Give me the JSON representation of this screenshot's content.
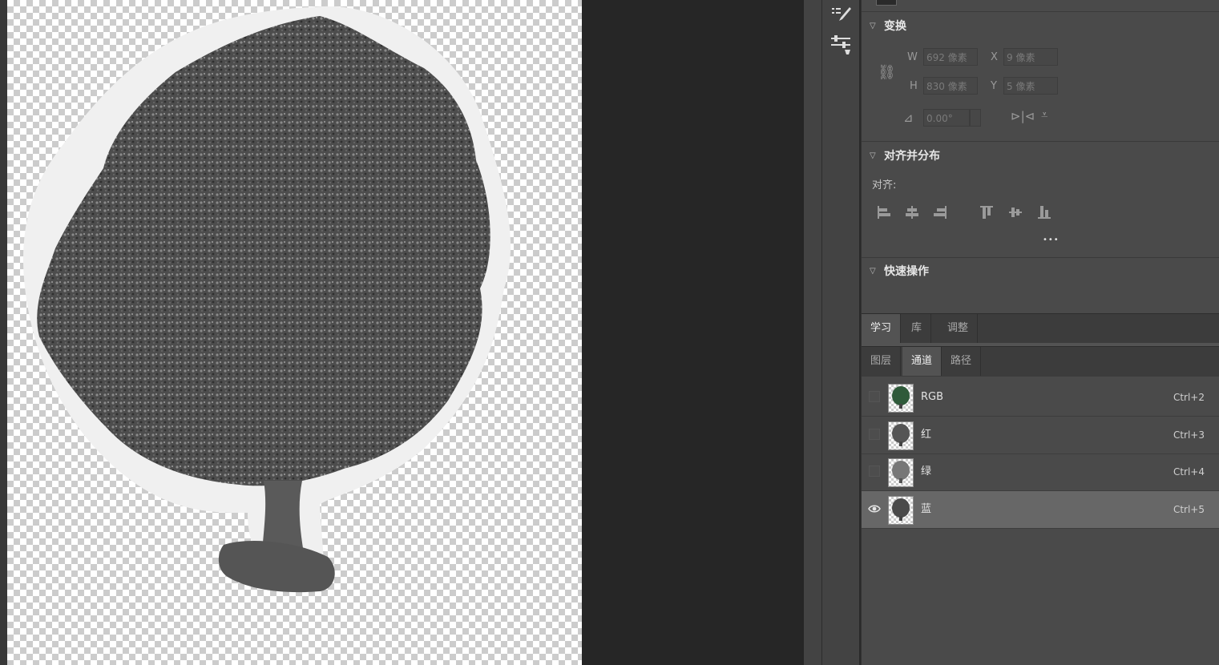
{
  "transform": {
    "title": "变换",
    "w_label": "W",
    "w_value": "692 像素",
    "x_label": "X",
    "x_value": "9 像素",
    "h_label": "H",
    "h_value": "830 像素",
    "y_label": "Y",
    "y_value": "5 像素",
    "angle_value": "0.00°"
  },
  "align": {
    "title": "对齐并分布",
    "label": "对齐:",
    "more": "•••"
  },
  "quick_actions": {
    "title": "快速操作"
  },
  "tabs_top": [
    {
      "label": "学习"
    },
    {
      "label": "库"
    },
    {
      "label": "调整"
    }
  ],
  "tabs_bottom": [
    {
      "label": "图层"
    },
    {
      "label": "通道"
    },
    {
      "label": "路径"
    }
  ],
  "channels": [
    {
      "name": "RGB",
      "shortcut": "Ctrl+2",
      "visible": false,
      "thumb_color": "#2f5a3a"
    },
    {
      "name": "红",
      "shortcut": "Ctrl+3",
      "visible": false,
      "thumb_color": "#555555"
    },
    {
      "name": "绿",
      "shortcut": "Ctrl+4",
      "visible": false,
      "thumb_color": "#777777"
    },
    {
      "name": "蓝",
      "shortcut": "Ctrl+5",
      "visible": true,
      "thumb_color": "#4a4a4a"
    }
  ],
  "colors": {
    "panel_bg": "#4a4a4a",
    "selected_row": "#676767",
    "canvas_dark": "#262626"
  }
}
